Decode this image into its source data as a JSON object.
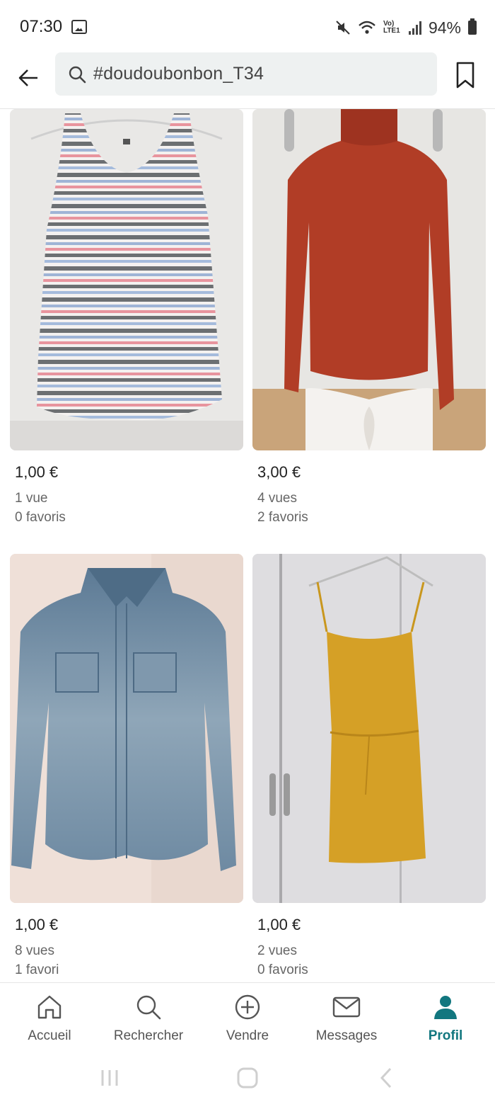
{
  "status_bar": {
    "time": "07:30",
    "battery": "94%",
    "network": "Vo) LTE1"
  },
  "search": {
    "query": "#doudoubonbon_T34"
  },
  "listings": [
    {
      "price": "1,00 €",
      "views": "1 vue",
      "favorites": "0 favoris",
      "photo": "striped-tank-top"
    },
    {
      "price": "3,00 €",
      "views": "4 vues",
      "favorites": "2 favoris",
      "photo": "red-turtleneck-sweater"
    },
    {
      "price": "1,00 €",
      "views": "8 vues",
      "favorites": "1 favori",
      "photo": "denim-shirt"
    },
    {
      "price": "1,00 €",
      "views": "2 vues",
      "favorites": "0 favoris",
      "photo": "mustard-dress"
    }
  ],
  "bottom_nav": [
    {
      "label": "Accueil",
      "icon": "home-icon"
    },
    {
      "label": "Rechercher",
      "icon": "search-icon"
    },
    {
      "label": "Vendre",
      "icon": "plus-circle-icon"
    },
    {
      "label": "Messages",
      "icon": "mail-icon"
    },
    {
      "label": "Profil",
      "icon": "person-icon",
      "active": true
    }
  ],
  "colors": {
    "accent": "#12777f",
    "search_bg": "#eef1f1"
  }
}
